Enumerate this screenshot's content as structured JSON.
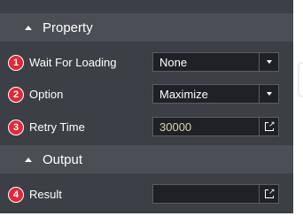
{
  "property_section": {
    "title": "Property",
    "rows": [
      {
        "badge": "1",
        "label": "Wait For Loading",
        "value": "None"
      },
      {
        "badge": "2",
        "label": "Option",
        "value": "Maximize"
      },
      {
        "badge": "3",
        "label": "Retry Time",
        "value": "30000"
      }
    ]
  },
  "output_section": {
    "title": "Output",
    "rows": [
      {
        "badge": "4",
        "label": "Result",
        "value": ""
      }
    ]
  },
  "icons": {
    "collapse": "chevron-up-icon",
    "dropdown": "chevron-down-icon",
    "open_external": "open-external-icon"
  },
  "colors": {
    "panel_bg": "#3c3f45",
    "header_bg": "#4b4e55",
    "field_bg": "#1f2126",
    "badge": "#e0283a",
    "number_text": "#d7d9a8"
  }
}
